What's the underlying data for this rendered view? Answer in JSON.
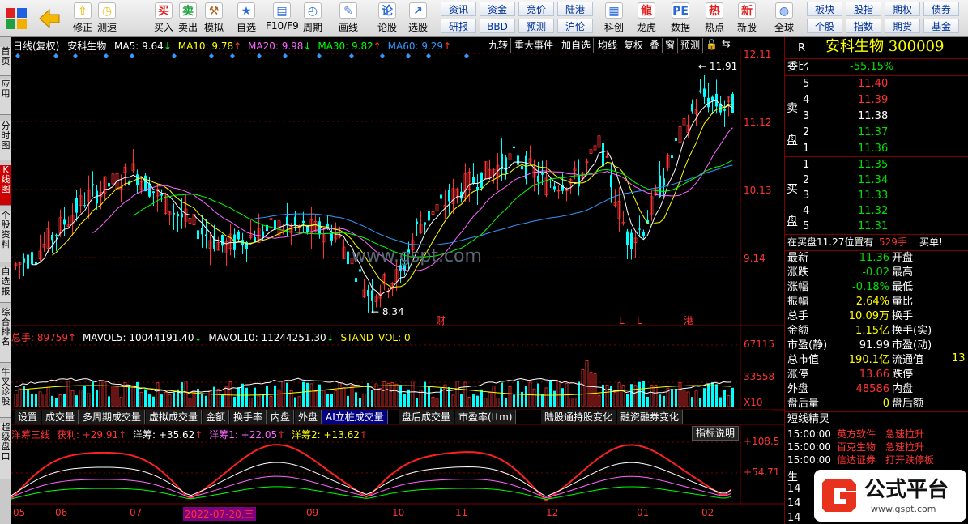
{
  "toolbar": {
    "left_buttons": [
      {
        "label": "修正",
        "icon": "arrow-up-icon"
      },
      {
        "label": "测速",
        "icon": "speed-icon"
      },
      {
        "label": "买入",
        "icon": "buy-icon"
      },
      {
        "label": "卖出",
        "icon": "sell-icon"
      },
      {
        "label": "模拟",
        "icon": "gavel-icon"
      },
      {
        "label": "自选",
        "icon": "star-icon"
      },
      {
        "label": "F10/F9",
        "icon": "document-icon"
      },
      {
        "label": "周期",
        "icon": "cycle-icon"
      },
      {
        "label": "画线",
        "icon": "pen-icon"
      },
      {
        "label": "论股",
        "icon": "discuss-icon"
      },
      {
        "label": "选股",
        "icon": "select-icon"
      }
    ],
    "small_buttons_top": [
      "资讯",
      "资金",
      "竞价",
      "陆港"
    ],
    "small_buttons_bottom": [
      "研报",
      "BBD",
      "预测",
      "沪伦"
    ],
    "mid_buttons": [
      {
        "label": "科创",
        "icon": "chart-icon"
      },
      {
        "label": "龙虎",
        "icon": "dragon-icon"
      },
      {
        "label": "数据",
        "icon": "pe-icon"
      },
      {
        "label": "热点",
        "icon": "hot-icon"
      },
      {
        "label": "新股",
        "icon": "newstock-icon"
      },
      {
        "label": "全球",
        "icon": "globe-icon"
      }
    ],
    "right_top": [
      "板块",
      "股指",
      "期权",
      "债券"
    ],
    "right_bottom": [
      "个股",
      "指数",
      "期货",
      "基金"
    ]
  },
  "sidetabs": [
    "首页",
    "应用",
    "分时图",
    "K线图",
    "个股资料",
    "自选报",
    "综合排名",
    "牛叉诊股",
    "超级盘口"
  ],
  "chart_header": {
    "period": "日线(复权)",
    "name": "安科生物",
    "ma5": "MA5: 9.64",
    "ma10": "MA10: 9.78",
    "ma20": "MA20: 9.98",
    "ma30": "MA30: 9.82",
    "ma60": "MA60: 9.29",
    "tools": [
      "九转",
      "重大事件",
      "加自选",
      "均线",
      "复权",
      "叠",
      "窗",
      "预测"
    ]
  },
  "price_axis": [
    "12.11",
    "11.12",
    "10.13",
    "9.14"
  ],
  "price_marks": {
    "high": "11.91",
    "low": "8.34"
  },
  "event_marks": [
    "财",
    "L",
    "L",
    "港"
  ],
  "watermark": "www.gspt.com",
  "volume_header": {
    "total": "总手: 89759",
    "mavol5": "MAVOL5: 10044191.40",
    "mavol10": "MAVOL10: 11244251.30",
    "stand": "STAND_VOL: 0"
  },
  "volume_axis": [
    "67115",
    "33558",
    "X10"
  ],
  "bottom_tabs": [
    "设置",
    "成交量",
    "多周期成交量",
    "虚拟成交量",
    "金额",
    "换手率",
    "内盘",
    "外盘",
    "AI立桩成交量",
    "盘后成交量",
    "市盈率(ttm)",
    "陆股通持股变化",
    "融资融券变化"
  ],
  "indicator_header": {
    "name": "洋筹三线",
    "profit": "获利: +29.91",
    "yc": "洋筹: +35.62",
    "yc1": "洋筹1: +22.05",
    "yc2": "洋筹2: +13.62",
    "explain": "指标说明"
  },
  "indicator_axis": [
    "+108.5",
    "+54.71"
  ],
  "time_axis": [
    "05",
    "06",
    "07",
    "2022-07-20,三",
    "09",
    "10",
    "11",
    "12",
    "01",
    "02"
  ],
  "right_panel": {
    "code_prefix": "R",
    "title": "安科生物 300009",
    "weibi_label": "委比",
    "weibi_value": "-55.15%",
    "sell_label": "卖盘",
    "buy_label": "买盘",
    "sell": [
      {
        "level": "5",
        "price": "11.40"
      },
      {
        "level": "4",
        "price": "11.39"
      },
      {
        "level": "3",
        "price": "11.38"
      },
      {
        "level": "2",
        "price": "11.37"
      },
      {
        "level": "1",
        "price": "11.36"
      }
    ],
    "buy": [
      {
        "level": "1",
        "price": "11.35"
      },
      {
        "level": "2",
        "price": "11.34"
      },
      {
        "level": "3",
        "price": "11.33"
      },
      {
        "level": "4",
        "price": "11.32"
      },
      {
        "level": "5",
        "price": "11.31"
      }
    ],
    "order_note": "在买盘11.27位置有",
    "order_qty": "529手",
    "order_type": "买单!",
    "stats": [
      {
        "label": "最新",
        "value": "11.36",
        "label2": "开盘",
        "color": "green"
      },
      {
        "label": "涨跌",
        "value": "-0.02",
        "label2": "最高",
        "color": "green"
      },
      {
        "label": "涨幅",
        "value": "-0.18%",
        "label2": "最低",
        "color": "green"
      },
      {
        "label": "振幅",
        "value": "2.64%",
        "label2": "量比",
        "color": "yellow"
      },
      {
        "label": "总手",
        "value": "10.09万",
        "label2": "换手",
        "color": "yellow"
      },
      {
        "label": "金额",
        "value": "1.15亿",
        "label2": "换手(实)",
        "color": "yellow"
      },
      {
        "label": "市盈(静)",
        "value": "91.99",
        "label2": "市盈(动)",
        "color": "white"
      },
      {
        "label": "总市值",
        "value": "190.1亿",
        "label2": "流通值",
        "color": "yellow"
      },
      {
        "label": "涨停",
        "value": "13.66",
        "label2": "跌停",
        "color": "red"
      },
      {
        "label": "外盘",
        "value": "48586",
        "label2": "内盘",
        "color": "red"
      },
      {
        "label": "盘后量",
        "value": "0",
        "label2": "盘后额",
        "color": "yellow"
      }
    ],
    "liutong_partial": "13",
    "short_title": "短线精灵",
    "short_items": [
      {
        "time": "15:00:00",
        "name": "英方软件",
        "event": "急速拉升"
      },
      {
        "time": "15:00:00",
        "name": "百克生物",
        "event": "急速拉升"
      },
      {
        "time": "15:00:00",
        "name": "信达证券",
        "event": "打开跌停板"
      }
    ],
    "bottom_partial": [
      "生",
      "14",
      "14",
      "14"
    ],
    "brand": "公式平台",
    "brand_url": "www.gspt.com"
  },
  "colors": {
    "up": "#ff3333",
    "down": "#00ffff",
    "ma5": "#ffffff",
    "ma10": "#ffff00",
    "ma20": "#ff66ff",
    "ma30": "#00ff00",
    "ma60": "#3399ff"
  }
}
